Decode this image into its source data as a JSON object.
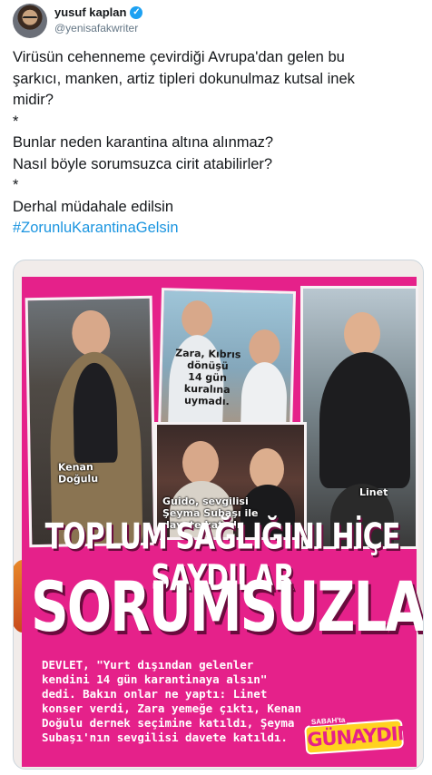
{
  "tweet": {
    "author": {
      "display_name": "yusuf kaplan",
      "handle": "@yenisafakwriter",
      "verified_icon": "verified-badge-icon"
    },
    "lines": [
      "Virüsün cehenneme çevirdiği Avrupa'dan gelen bu",
      "şarkıcı, manken, artiz tipleri dokunulmaz kutsal inek",
      "midir?",
      "*",
      "Bunlar neden karantina altına alınmaz?",
      "Nasıl böyle sorumsuzca cirit atabilirler?",
      "*",
      "Derhal müdahale edilsin"
    ],
    "hashtag": "#ZorunluKarantinaGelsin"
  },
  "media": {
    "captions": {
      "kenan": "Kenan\nDoğulu",
      "zara": "Zara, Kıbrıs\ndönüşü\n14 gün\nkuralına\nuymadı.",
      "guido": "Guido, sevgilisi\nŞeyma Subaşı ile\ndavete katıldı.",
      "linet": "Linet"
    },
    "headline_top": "TOPLUM SAĞLIĞINI HİÇE SAYDILAR",
    "headline_main": "SORUMSUZLAR",
    "body": "DEVLET, \"Yurt dışından gelenler kendini 14 gün karantinaya alsın\" dedi. Bakın onlar ne yaptı: Linet konser verdi, Zara yemeğe çıktı, Kenan Doğulu dernek seçimine katıldı, Şeyma Subaşı'nın sevgilisi davete katıldı.",
    "brand_small": "SABAH'ta",
    "brand": "GÜNAYDIN",
    "colors": {
      "magenta": "#e5218a",
      "brand_yellow": "#ffd21f",
      "hashtag_blue": "#1b95e0"
    }
  }
}
